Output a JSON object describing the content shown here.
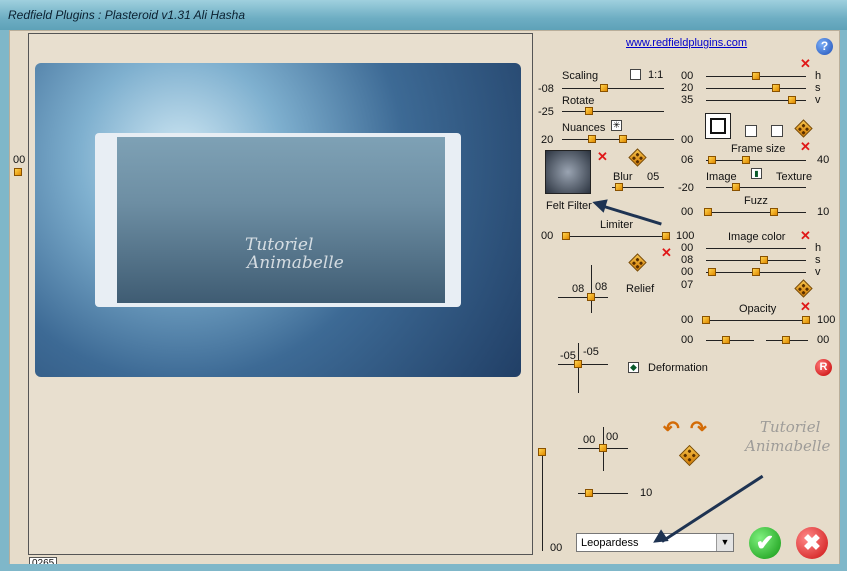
{
  "window": {
    "title": "Redfield Plugins : Plasteroid v1.31   Ali Hasha"
  },
  "top_value": "00",
  "left_value": "00",
  "bottom_left_value": "0265",
  "link": {
    "text": "www.redfieldplugins.com"
  },
  "watermark": {
    "line1": "Tutoriel",
    "line2": "Animabelle"
  },
  "controls": {
    "scaling": {
      "label": "Scaling",
      "value": "-08",
      "ratio_label": "1:1"
    },
    "rotate": {
      "label": "Rotate",
      "value": "-25"
    },
    "nuances": {
      "label": "Nuances",
      "value": "20",
      "value2": "00"
    },
    "blur": {
      "label": "Blur",
      "value": "05",
      "value2": "-20"
    },
    "felt_filter": {
      "label": "Felt Filter"
    },
    "limiter": {
      "label": "Limiter",
      "min": "00",
      "max": "100"
    },
    "relief": {
      "label": "Relief",
      "x": "08",
      "y": "08"
    },
    "deformation": {
      "label": "Deformation",
      "x": "-05",
      "y": "-05"
    },
    "offset": {
      "x": "00",
      "y": "00"
    },
    "zoom_value": "10",
    "vertical_value": "00"
  },
  "right_panel": {
    "hsv": {
      "h_label": "h",
      "s_label": "s",
      "v_label": "v",
      "h": "00",
      "s": "20",
      "v": "35"
    },
    "frame_size": {
      "label": "Frame size",
      "min": "06",
      "max": "40"
    },
    "image": {
      "label": "Image",
      "texture_label": "Texture"
    },
    "fuzz": {
      "label": "Fuzz",
      "min": "00",
      "max": "10"
    },
    "image_color": {
      "label": "Image color",
      "h_label": "h",
      "s_label": "s",
      "v_label": "v",
      "h": "00",
      "s": "08",
      "v": "00",
      "extra": "07"
    },
    "opacity": {
      "label": "Opacity",
      "min": "00",
      "max": "100",
      "low_left": "00",
      "low_right": "00"
    }
  },
  "preset": {
    "selected": "Leopardess"
  },
  "buttons": {
    "ok": "✔",
    "cancel": "✖",
    "help": "?",
    "reset": "R"
  }
}
